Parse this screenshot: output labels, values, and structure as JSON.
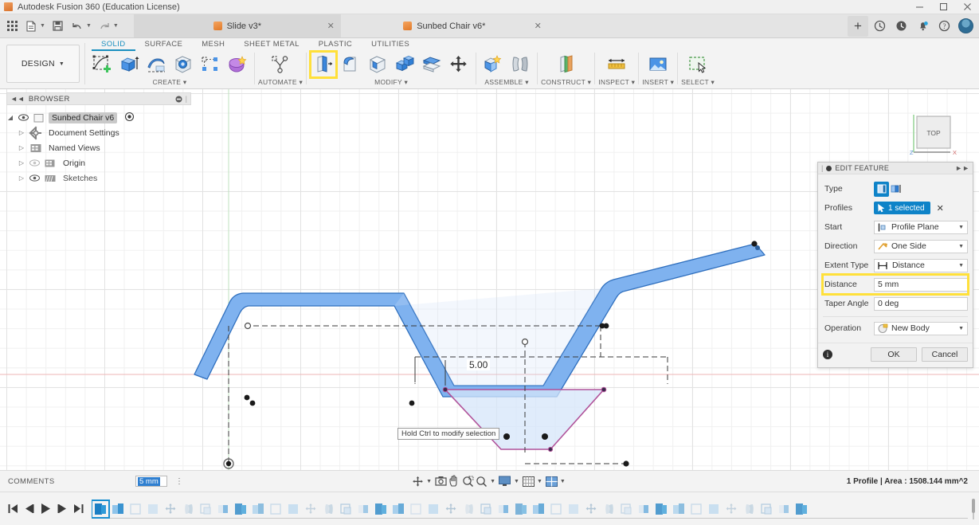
{
  "window": {
    "title": "Autodesk Fusion 360 (Education License)",
    "minimize": "minimize-button",
    "maximize": "maximize-button",
    "close": "close-button"
  },
  "quick_access": {
    "grid_label": "apps-grid",
    "file_label": "file",
    "save_label": "save",
    "undo_label": "undo",
    "redo_label": "redo"
  },
  "tabs": [
    {
      "label": "Slide v3*",
      "active": true,
      "closable": true
    },
    {
      "label": "Sunbed Chair v6*",
      "active": false,
      "closable": true
    }
  ],
  "tab_actions": {
    "new_tab": "+",
    "history": "history-icon",
    "recent": "recent-icon",
    "notifications": "bell-icon",
    "help": "help-icon",
    "account": "account-avatar"
  },
  "workspace": {
    "selector_label": "DESIGN",
    "ribbon_tabs": [
      {
        "label": "SOLID",
        "active": true
      },
      {
        "label": "SURFACE",
        "active": false
      },
      {
        "label": "MESH",
        "active": false
      },
      {
        "label": "SHEET METAL",
        "active": false
      },
      {
        "label": "PLASTIC",
        "active": false
      },
      {
        "label": "UTILITIES",
        "active": false
      }
    ],
    "tool_groups": [
      {
        "label": "CREATE",
        "dropdown": true,
        "tools": [
          "create-sketch-icon",
          "extrude-icon",
          "revolve-icon",
          "hole-icon",
          "rectangular-pattern-icon",
          "create-form-icon"
        ]
      },
      {
        "label": "AUTOMATE",
        "dropdown": true,
        "tools": [
          "automate-icon"
        ]
      },
      {
        "label": "MODIFY",
        "dropdown": true,
        "highlighted_tool": "press-pull-icon",
        "tools": [
          "press-pull-icon",
          "fillet-icon",
          "shell-icon",
          "combine-icon",
          "split-face-icon",
          "move-copy-icon"
        ]
      },
      {
        "label": "ASSEMBLE",
        "dropdown": true,
        "tools": [
          "new-component-icon",
          "joint-icon"
        ]
      },
      {
        "label": "CONSTRUCT",
        "dropdown": true,
        "tools": [
          "offset-plane-icon"
        ]
      },
      {
        "label": "INSPECT",
        "dropdown": true,
        "tools": [
          "measure-icon"
        ]
      },
      {
        "label": "INSERT",
        "dropdown": true,
        "tools": [
          "insert-image-icon"
        ]
      },
      {
        "label": "SELECT",
        "dropdown": true,
        "tools": [
          "select-window-icon"
        ]
      }
    ]
  },
  "browser": {
    "title": "BROWSER",
    "collapse_icon": "collapse-left-icon",
    "settings_icon": "browser-options-icon",
    "tree": [
      {
        "label": "Sunbed Chair v6",
        "icon": "component-icon",
        "selected": true,
        "expanded": true,
        "has_eye": true,
        "has_radio": true,
        "indent": 0
      },
      {
        "label": "Document Settings",
        "icon": "gear-icon",
        "selected": false,
        "expanded": false,
        "has_eye": false,
        "has_radio": false,
        "indent": 1
      },
      {
        "label": "Named Views",
        "icon": "views-icon",
        "selected": false,
        "expanded": false,
        "has_eye": false,
        "has_radio": false,
        "indent": 1
      },
      {
        "label": "Origin",
        "icon": "origin-icon",
        "selected": false,
        "expanded": false,
        "has_eye": true,
        "has_radio": false,
        "indent": 1
      },
      {
        "label": "Sketches",
        "icon": "sketches-icon",
        "selected": false,
        "expanded": false,
        "has_eye": true,
        "has_radio": false,
        "indent": 1
      }
    ]
  },
  "viewcube": {
    "face_label": "TOP",
    "axis_z": "Z",
    "axis_x": "X"
  },
  "canvas": {
    "dimension_label": "5.00",
    "tooltip": "Hold Ctrl to modify selection",
    "profile_fill": "#7fb2ef",
    "profile_stroke": "#2f6fbe",
    "selected_profile_stroke": "#b0539a",
    "selected_profile_fill": "#d5e5fa",
    "origin_axis_x_color": "#e8a0a0",
    "origin_axis_y_color": "#a8d8a8"
  },
  "dialog": {
    "title": "EDIT FEATURE",
    "collapse_icon": "expand-right-icon",
    "rows": [
      {
        "label": "Type",
        "kind": "icons",
        "value": "",
        "options": [
          "extrude-profile-icon",
          "extrude-edge-icon"
        ],
        "selected_index": 0
      },
      {
        "label": "Profiles",
        "kind": "selection",
        "value": "1 selected",
        "clear": "x-clear-icon"
      },
      {
        "label": "Start",
        "kind": "dropdown",
        "value": "Profile Plane",
        "icon": "profile-plane-icon"
      },
      {
        "label": "Direction",
        "kind": "dropdown",
        "value": "One Side",
        "icon": "direction-icon"
      },
      {
        "label": "Extent Type",
        "kind": "dropdown",
        "value": "Distance",
        "icon": "distance-icon"
      },
      {
        "label": "Distance",
        "kind": "value",
        "value": "5 mm",
        "highlighted": true
      },
      {
        "label": "Taper Angle",
        "kind": "value",
        "value": "0 deg",
        "highlighted": false
      },
      {
        "label": "Operation",
        "kind": "dropdown",
        "value": "New Body",
        "icon": "new-body-icon"
      }
    ],
    "info_icon": "info-icon",
    "ok_label": "OK",
    "cancel_label": "Cancel"
  },
  "status_bar": {
    "comments_label": "COMMENTS",
    "comment_value": "5 mm",
    "kebab": "more-options-icon",
    "nav_tools": [
      {
        "name": "orbit-icon",
        "has_caret": true
      },
      {
        "name": "look-at-icon",
        "has_caret": false
      },
      {
        "name": "pan-icon",
        "has_caret": false
      },
      {
        "name": "zoom-window-icon",
        "has_caret": false
      },
      {
        "name": "zoom-icon",
        "has_caret": true
      },
      {
        "name": "display-settings-icon",
        "has_caret": true
      },
      {
        "name": "grid-snaps-icon",
        "has_caret": true
      },
      {
        "name": "viewports-icon",
        "has_caret": true
      }
    ],
    "selection_info": "1 Profile | Area : 1508.144 mm^2"
  },
  "timeline": {
    "controls": [
      "jump-start-icon",
      "step-back-icon",
      "play-icon",
      "step-forward-icon",
      "jump-end-icon"
    ],
    "selected_index": 0,
    "features": [
      "extrude-feature",
      "extrude-feature-2",
      "sketch-feature",
      "extrude-feature-3",
      "move-feature",
      "move-feature-2",
      "move-feature-3",
      "mirror-feature",
      "sketch-feature-2",
      "extrude-feature-4",
      "rectangular-pattern-feature",
      "move-feature-4",
      "copy-feature",
      "move-feature-5",
      "move-feature-6",
      "move-feature-7",
      "move-feature-8",
      "move-feature-9",
      "move-feature-10",
      "move-feature-11",
      "move-feature-12",
      "move-feature-13",
      "move-feature-14",
      "combine-feature",
      "move-feature-15",
      "move-feature-16",
      "move-feature-17",
      "move-feature-18",
      "move-feature-19",
      "move-feature-20",
      "move-feature-21",
      "move-feature-22",
      "appearance-feature",
      "move-feature-23",
      "move-feature-24",
      "move-feature-25",
      "move-feature-26",
      "move-feature-27",
      "box-feature",
      "move-feature-28",
      "move-feature-29"
    ],
    "end_marker": "timeline-end-marker"
  }
}
